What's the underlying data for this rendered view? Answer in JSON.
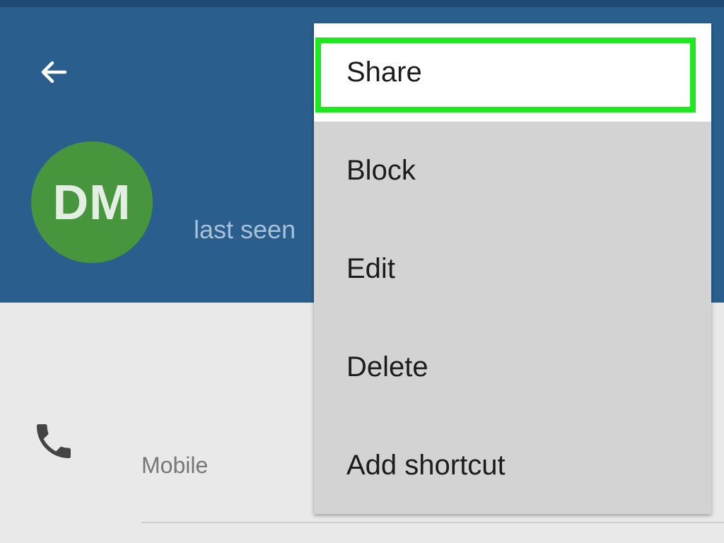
{
  "header": {
    "back_icon": "arrow-left-icon",
    "avatar_initials": "DM",
    "contact_name": "",
    "last_seen": "last seen",
    "colors": {
      "header_bg": "#2a5e8d",
      "avatar_bg": "#47963e"
    }
  },
  "contact": {
    "phone_icon": "phone-icon",
    "phone_number": "",
    "phone_type": "Mobile"
  },
  "menu": {
    "items": [
      {
        "label": "Share",
        "highlighted": true
      },
      {
        "label": "Block"
      },
      {
        "label": "Edit"
      },
      {
        "label": "Delete"
      },
      {
        "label": "Add shortcut"
      }
    ],
    "highlight_color": "#1ee81e"
  }
}
